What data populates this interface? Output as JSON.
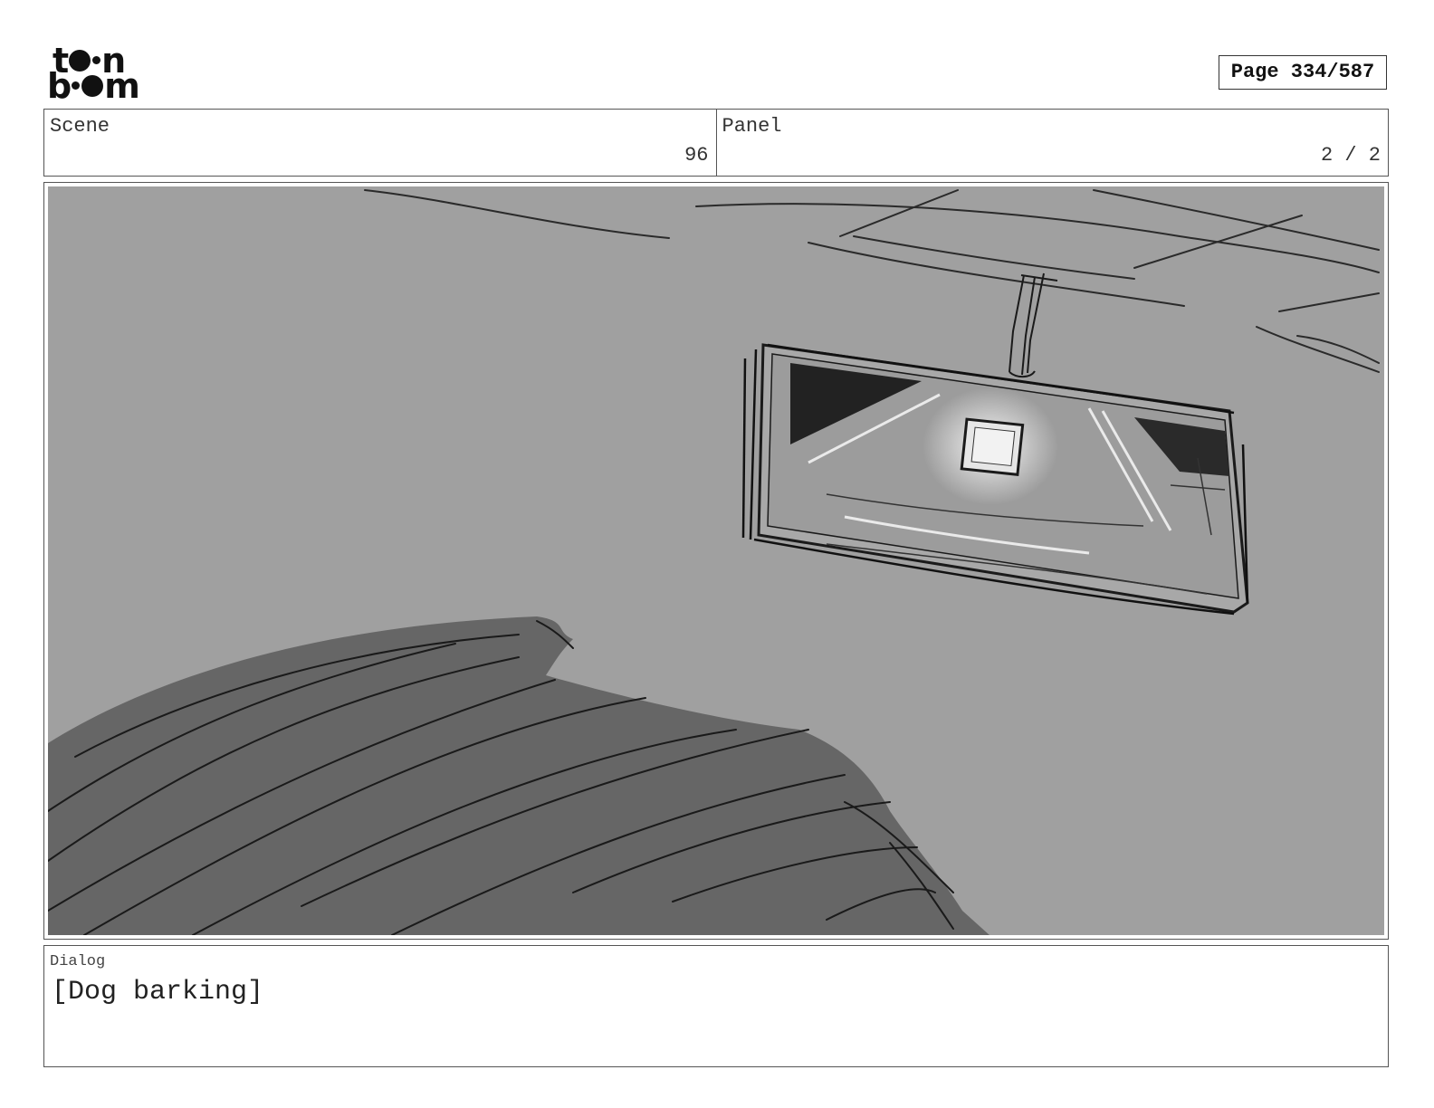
{
  "header": {
    "logo": {
      "text_top": "toon",
      "text_bottom": "boom",
      "name": "toon boom"
    },
    "page_label": "Page 334/587"
  },
  "info": {
    "scene_label": "Scene",
    "scene_value": "96",
    "panel_label": "Panel",
    "panel_value": "2 / 2"
  },
  "panel": {
    "image_name": "rearview-mirror-sketch",
    "colors": {
      "background": "#a0a0a0",
      "foreground_shape": "#666666",
      "ink": "#1a1a1a",
      "highlight": "#f2f2f2"
    }
  },
  "dialog": {
    "label": "Dialog",
    "text": "[Dog barking]"
  }
}
